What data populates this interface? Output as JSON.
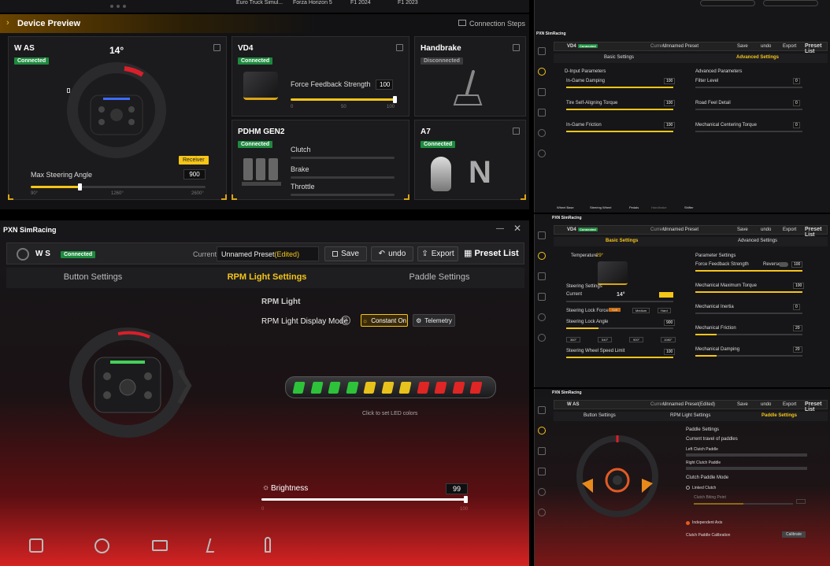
{
  "top_strip": {
    "games": [
      "Euro Truck Simul...",
      "Forza Horizon 5",
      "F1 2024",
      "F1 2023"
    ]
  },
  "device_preview": {
    "title": "Device Preview",
    "connection_steps": "Connection Steps",
    "w_as": {
      "name": "W AS",
      "status": "Connected",
      "angle": "14°",
      "receiver": "Receiver",
      "max_steering_label": "Max Steering Angle",
      "max_steering_value": "900",
      "scale": [
        "90°",
        "1260°",
        "2600°"
      ],
      "fill": 0.28
    },
    "vd4": {
      "name": "VD4",
      "status": "Connected",
      "ffb_label": "Force Feedback Strength",
      "ffb_value": "100",
      "scale": [
        "0",
        "50",
        "100"
      ],
      "fill": 1.0
    },
    "handbrake": {
      "name": "Handbrake",
      "status": "Disconnected"
    },
    "pdhm": {
      "name": "PDHM GEN2",
      "status": "Connected",
      "pedals": [
        "Clutch",
        "Brake",
        "Throttle"
      ]
    },
    "a7": {
      "name": "A7",
      "status": "Connected",
      "gear": "N"
    }
  },
  "main_window": {
    "app_title": "PXN SimRacing",
    "device_name": "W  S",
    "status": "Connected",
    "current_label": "Current",
    "preset_name": "Unnamed Preset",
    "preset_edited": "(Edited)",
    "save": "Save",
    "undo": "undo",
    "export": "Export",
    "preset_list": "Preset List",
    "tabs": [
      "Button Settings",
      "RPM Light Settings",
      "Paddle Settings"
    ],
    "rpm_section": "RPM Light",
    "display_mode_label": "RPM Light Display Mode",
    "mode_constant": "Constant On",
    "mode_telemetry": "Telemetry",
    "led_hint": "Click to set LED colors",
    "led_colors": [
      "#2ec23a",
      "#2ec23a",
      "#2ec23a",
      "#2ec23a",
      "#e8c21c",
      "#e8c21c",
      "#e8c21c",
      "#e02525",
      "#e02525",
      "#e02525",
      "#e02525"
    ],
    "brightness_label": "Brightness",
    "brightness_value": "99",
    "brightness_fill": 0.99,
    "scale_min": "0",
    "scale_max": "100"
  },
  "right_windows": {
    "app_title": "PXN SimRacing",
    "sidebar": [
      "Home",
      "Devices",
      "Games",
      "Update",
      "Help",
      "Settings"
    ],
    "vd4_a": {
      "device": "VD4",
      "status": "Connected",
      "current": "Current",
      "preset": "Unnamed Preset",
      "save": "Save",
      "undo": "undo",
      "export": "Export",
      "preset_list": "Preset List",
      "tabs": [
        "Basic Settings",
        "Advanced Settings"
      ],
      "left_title": "D-Input Parameters",
      "left_params": [
        {
          "label": "In-Game Damping",
          "value": "100",
          "fill": 1.0
        },
        {
          "label": "Tire Self-Aligning Torque",
          "value": "100",
          "fill": 1.0
        },
        {
          "label": "In-Game Friction",
          "value": "100",
          "fill": 1.0
        }
      ],
      "right_title": "Advanced Parameters",
      "right_params": [
        {
          "label": "Filter Level",
          "value": "0",
          "fill": 0.0
        },
        {
          "label": "Road Feel Detail",
          "value": "0",
          "fill": 0.0
        },
        {
          "label": "Mechanical Centering Torque",
          "value": "0",
          "fill": 0.0
        }
      ],
      "bottom_nav": [
        "Wheel Base",
        "Steering Wheel",
        "Pedals",
        "Handbrake",
        "Shifter"
      ]
    },
    "vd4_b": {
      "device": "VD4",
      "status": "Connected",
      "current": "Current",
      "preset": "Unnamed Preset",
      "save": "Save",
      "undo": "undo",
      "export": "Export",
      "preset_list": "Preset List",
      "tabs": [
        "Basic Settings",
        "Advanced Settings"
      ],
      "temperature_label": "Temperature",
      "temperature_value": "29°",
      "steering_title": "Steering Settings",
      "current_angle_label": "Current",
      "current_angle": "14°",
      "lock_force_label": "Steering Lock Force",
      "lock_options": [
        "Soft",
        "Medium",
        "Hard"
      ],
      "lock_angle_label": "Steering Lock Angle",
      "lock_angle_value": "900",
      "angle_presets": [
        "360°",
        "540°",
        "900°",
        "1080°"
      ],
      "speed_limit_label": "Steering Wheel Speed Limit",
      "speed_limit_value": "100",
      "param_title": "Parameter Settings",
      "ffb_label": "Force Feedback Strength",
      "reverse_label": "Reverse",
      "ffb_value": "100",
      "params": [
        {
          "label": "Mechanical Maximum Torque",
          "value": "100",
          "fill": 1.0
        },
        {
          "label": "Mechanical Inertia",
          "value": "0",
          "fill": 0.0
        },
        {
          "label": "Mechanical Friction",
          "value": "20",
          "fill": 0.2
        },
        {
          "label": "Mechanical Damping",
          "value": "20",
          "fill": 0.2
        }
      ]
    },
    "was_c": {
      "device": "W AS",
      "current": "Current",
      "preset": "Unnamed Preset(Edited)",
      "save": "Save",
      "undo": "undo",
      "export": "Export",
      "preset_list": "Preset List",
      "tabs": [
        "Button Settings",
        "RPM Light Settings",
        "Paddle Settings"
      ],
      "paddle_title": "Paddle Settings",
      "travel_label": "Current travel of paddles",
      "left_clutch": "Left Clutch Paddle",
      "right_clutch": "Right Clutch Paddle",
      "mode_label": "Clutch Paddle Mode",
      "linked": "Linked Clutch",
      "bite_point": "Clutch Biting Point",
      "independent": "Independent Axis",
      "calibration_label": "Clutch Paddle Calibration",
      "calibrate": "Calibrate"
    }
  }
}
